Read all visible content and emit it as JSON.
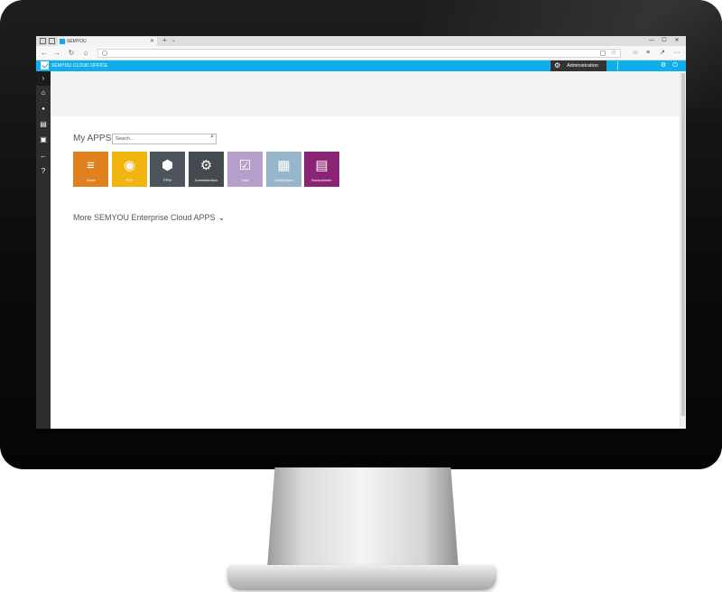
{
  "browser": {
    "tab_title": "SEMYOU",
    "tab_close": "✕",
    "new_tab": "+",
    "tab_menu": "⌄",
    "window_controls": [
      "—",
      "☐",
      "✕"
    ],
    "nav": {
      "back": "←",
      "forward": "→",
      "refresh": "↻",
      "home": "⌂"
    },
    "toolbar": {
      "favorites": "☆",
      "reading": "≡",
      "share": "↗",
      "more": "···"
    },
    "star": "☆"
  },
  "header": {
    "app_title": "SEMYOU CLOUD OFFICE",
    "admin_label": "Administration",
    "admin_icon": "⚙",
    "settings_icon": "⚙",
    "power_icon": "⏻"
  },
  "sidebar": {
    "items": [
      {
        "name": "expand-chevron-icon",
        "glyph": "›"
      },
      {
        "name": "home-icon",
        "glyph": "⌂"
      },
      {
        "name": "user-icon",
        "glyph": "●"
      },
      {
        "name": "document-icon",
        "glyph": "▤"
      },
      {
        "name": "contacts-icon",
        "glyph": "▣"
      },
      {
        "name": "back-arrow-icon",
        "glyph": "←"
      },
      {
        "name": "help-icon",
        "glyph": "?"
      }
    ]
  },
  "main": {
    "apps_title": "My APPS",
    "search_placeholder": "Search...",
    "search_icon": "⌕",
    "tiles": [
      {
        "label": "Gantt",
        "color": "#e1801e",
        "icon": "≡"
      },
      {
        "label": "PDF",
        "color": "#f2b40f",
        "icon": "◉"
      },
      {
        "label": "PPM",
        "color": "#4d545c",
        "icon": "⬢"
      },
      {
        "label": "Administration",
        "color": "#444a50",
        "icon": "⚙"
      },
      {
        "label": "Task",
        "color": "#b79fcd",
        "icon": "☑"
      },
      {
        "label": "VerityBoard",
        "color": "#97b6cc",
        "icon": "▦"
      },
      {
        "label": "Bookplanner",
        "color": "#8c2475",
        "icon": "▤"
      }
    ],
    "more_apps": "More SEMYOU Enterprise Cloud APPS",
    "more_chevron": "⌄"
  }
}
